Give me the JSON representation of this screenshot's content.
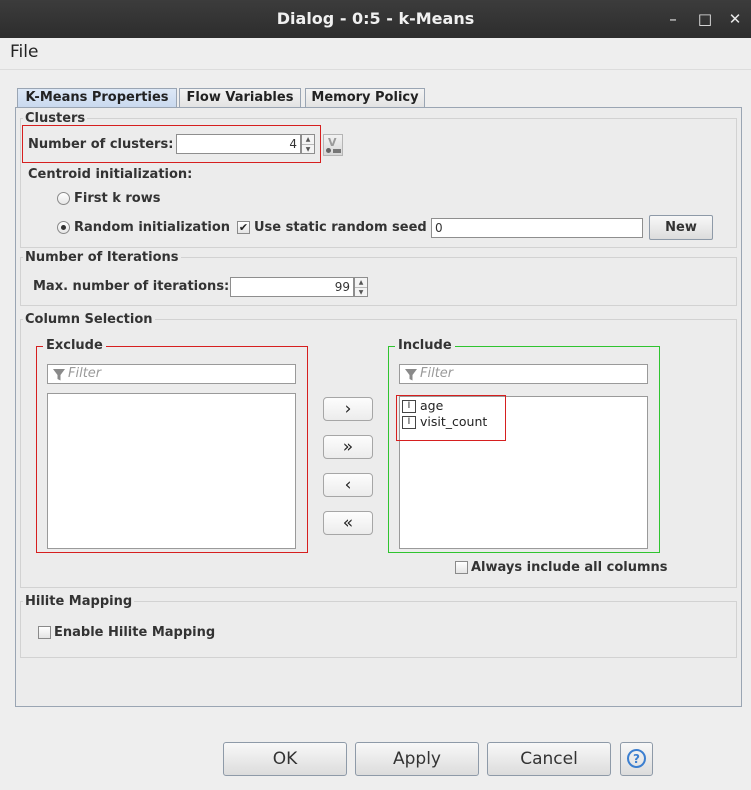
{
  "window": {
    "title": "Dialog - 0:5 - k-Means",
    "controls": {
      "minimize": "–",
      "maximize": "□",
      "close": "✕"
    }
  },
  "menu": {
    "file": "File"
  },
  "tabs": [
    {
      "label": "K-Means Properties",
      "active": true
    },
    {
      "label": "Flow Variables",
      "active": false
    },
    {
      "label": "Memory Policy",
      "active": false
    }
  ],
  "clusters": {
    "legend": "Clusters",
    "num_clusters_label": "Number of clusters:",
    "num_clusters_value": "4",
    "centroid_init_label": "Centroid initialization:",
    "first_k_rows_label": "First k rows",
    "random_init_label": "Random initialization",
    "selected_init": "Random initialization",
    "static_seed_label": "Use static random seed",
    "static_seed_checked": true,
    "seed_value": "0",
    "new_button": "New"
  },
  "iterations": {
    "legend": "Number of Iterations",
    "max_label": "Max. number of iterations:",
    "max_value": "99"
  },
  "column_selection": {
    "legend": "Column Selection",
    "exclude_title": "Exclude",
    "include_title": "Include",
    "filter_placeholder": "Filter",
    "exclude_items": [],
    "include_items": [
      {
        "type_icon": "I",
        "name": "age"
      },
      {
        "type_icon": "I",
        "name": "visit_count"
      }
    ],
    "move_buttons": {
      "add": "›",
      "add_all": "»",
      "remove": "‹",
      "remove_all": "«"
    },
    "always_include_label": "Always include all columns",
    "always_include_checked": false
  },
  "hilite": {
    "legend": "Hilite Mapping",
    "enable_label": "Enable Hilite Mapping",
    "enable_checked": false
  },
  "footer": {
    "ok": "OK",
    "apply": "Apply",
    "cancel": "Cancel",
    "help": "?"
  },
  "colors": {
    "highlight_red": "#d61f1f",
    "highlight_green": "#2fc42f",
    "titlebar": "#333333"
  }
}
